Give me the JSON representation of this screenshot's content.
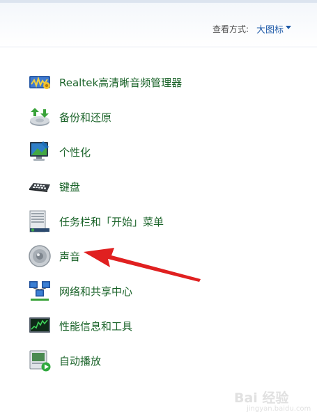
{
  "header": {
    "view_label": "查看方式:",
    "view_value": "大图标"
  },
  "items": [
    {
      "label": "Realtek高清晰音频管理器",
      "icon": "realtek-audio-icon"
    },
    {
      "label": "备份和还原",
      "icon": "backup-restore-icon"
    },
    {
      "label": "个性化",
      "icon": "personalization-icon"
    },
    {
      "label": "键盘",
      "icon": "keyboard-icon"
    },
    {
      "label": "任务栏和「开始」菜单",
      "icon": "taskbar-start-menu-icon"
    },
    {
      "label": "声音",
      "icon": "sound-icon"
    },
    {
      "label": "网络和共享中心",
      "icon": "network-sharing-icon"
    },
    {
      "label": "性能信息和工具",
      "icon": "performance-icon"
    },
    {
      "label": "自动播放",
      "icon": "autoplay-icon"
    }
  ],
  "watermark": {
    "text": "Bai 经验",
    "sub": "jingyan.baidu.com"
  },
  "colors": {
    "link_green": "#1a6329",
    "view_blue": "#1e5aa8",
    "arrow_red": "#e02020"
  }
}
